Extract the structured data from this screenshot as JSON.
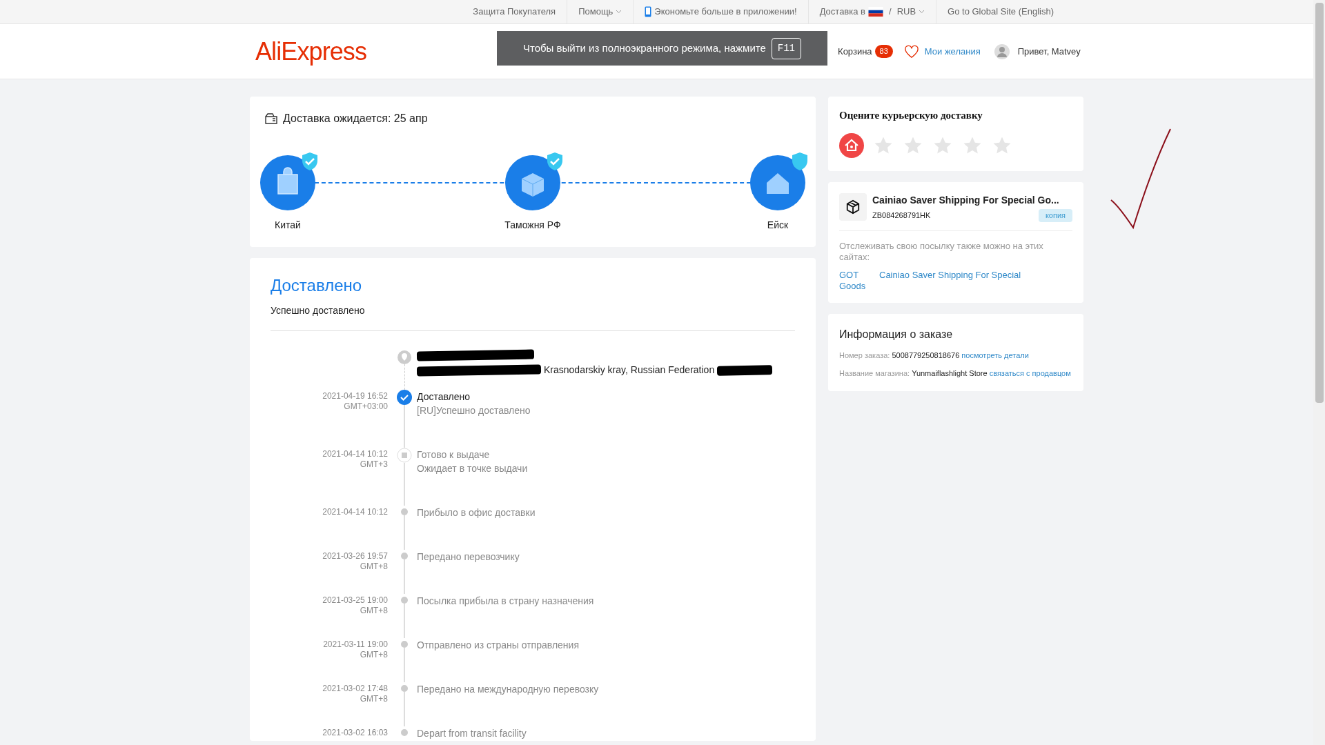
{
  "top_bar": {
    "links": [
      {
        "label": "Защита Покупателя",
        "kind": "plain"
      },
      {
        "label": "Помощь",
        "kind": "dropdown"
      },
      {
        "label": "Экономьте больше в приложении!",
        "kind": "phone"
      },
      {
        "label": "Доставка в",
        "kind": "flag"
      },
      {
        "label": "RUB",
        "kind": "dropdown"
      },
      {
        "label": "Go to Global Site (English)",
        "kind": "plain"
      }
    ],
    "separator": "/"
  },
  "header": {
    "logo": "AliExpress",
    "cart": {
      "label": "Корзина",
      "count": "83"
    },
    "wishlist": "Мои желания",
    "greeting": "Привет, Matvey"
  },
  "fullscreen_notice": {
    "text": "Чтобы выйти из полноэкранного режима, нажмите",
    "key": "F11"
  },
  "delivery": {
    "expected": "Доставка ожидается: 25 апр",
    "stages": [
      {
        "label": "Китай",
        "kind": "bag",
        "done": true
      },
      {
        "label": "Таможня РФ",
        "kind": "box",
        "done": true
      },
      {
        "label": "Ейск",
        "kind": "house",
        "done": false
      }
    ]
  },
  "status": {
    "title": "Доставлено",
    "subtitle": "Успешно доставлено",
    "address": "Krasnodarskiy kray,  Russian Federation",
    "events": [
      {
        "date": "2021-04-19 16:52",
        "tz": "GMT+03:00",
        "title": "Доставлено",
        "detail": "[RU]Успешно доставлено",
        "kind": "current"
      },
      {
        "date": "2021-04-14 10:12",
        "tz": "GMT+3",
        "title": "Готово к выдаче",
        "detail": "Ожидает в точке выдачи",
        "kind": "pickup"
      },
      {
        "date": "2021-04-14 10:12",
        "title": "Прибыло в офис доставки",
        "kind": "plain"
      },
      {
        "date": "2021-03-26 19:57",
        "tz": "GMT+8",
        "title": "Передано перевозчику",
        "kind": "plain"
      },
      {
        "date": "2021-03-25 19:00",
        "tz": "GMT+8",
        "title": "Посылка прибыла в страну назначения",
        "kind": "plain"
      },
      {
        "date": "2021-03-11 19:00",
        "tz": "GMT+8",
        "title": "Отправлено из страны отправления",
        "kind": "plain"
      },
      {
        "date": "2021-03-02 17:48",
        "tz": "GMT+8",
        "title": "Передано на международную перевозку",
        "kind": "plain"
      },
      {
        "date": "2021-03-02 16:03",
        "title": "Depart from transit facility",
        "kind": "plain"
      }
    ]
  },
  "rating": {
    "title": "Оцените курьерскую доставку",
    "stars": 0
  },
  "shipping": {
    "carrier": "Cainiao Saver Shipping For Special Go...",
    "tracking": "ZB084268791HK",
    "copy": "копия",
    "note": "Отслеживать свою посылку также можно на этих сайтах:",
    "sites": [
      "GOT Goods",
      "Cainiao Saver Shipping For Special"
    ]
  },
  "order": {
    "title": "Информация о заказе",
    "rows": [
      {
        "label": "Номер заказа:",
        "value": "5008779250818676",
        "link": "посмотреть детали"
      },
      {
        "label": "Название магазина:",
        "value": "Yunmaiflashlight Store",
        "link": "связаться с продавцом"
      }
    ]
  }
}
